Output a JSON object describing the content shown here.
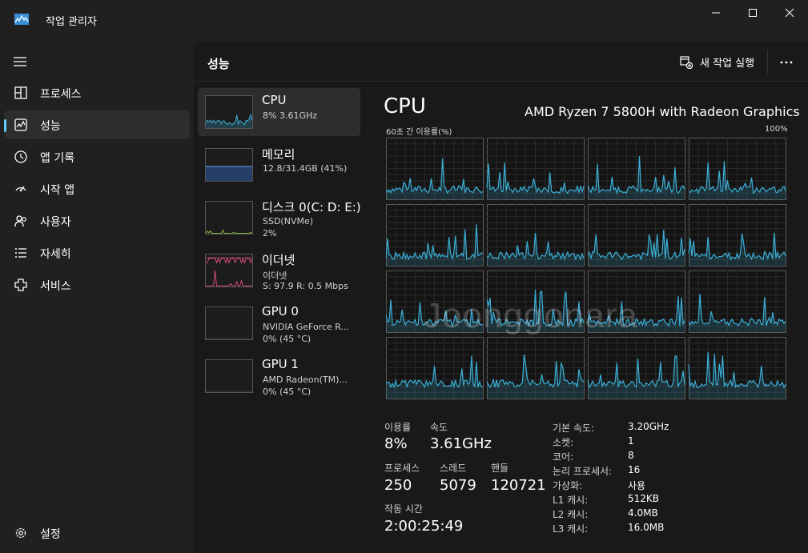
{
  "window": {
    "title": "작업 관리자"
  },
  "sidebar": {
    "items": [
      {
        "label": "프로세스",
        "icon": "processes-icon"
      },
      {
        "label": "성능",
        "icon": "performance-icon",
        "active": true
      },
      {
        "label": "앱 기록",
        "icon": "app-history-icon"
      },
      {
        "label": "시작 앱",
        "icon": "startup-apps-icon"
      },
      {
        "label": "사용자",
        "icon": "users-icon"
      },
      {
        "label": "자세히",
        "icon": "details-icon"
      },
      {
        "label": "서비스",
        "icon": "services-icon"
      }
    ],
    "settings_label": "설정"
  },
  "header": {
    "page_title": "성능",
    "run_task_label": "새 작업 실행",
    "more_label": "..."
  },
  "devices": [
    {
      "name": "CPU",
      "sub1": "8% 3.61GHz",
      "sub2": ""
    },
    {
      "name": "메모리",
      "sub1": "12.8/31.4GB (41%)",
      "sub2": ""
    },
    {
      "name": "디스크 0(C: D: E:)",
      "sub1": "SSD(NVMe)",
      "sub2": "2%"
    },
    {
      "name": "이더넷",
      "sub1": "이더넷",
      "sub2": "S: 97.9 R: 0.5 Mbps"
    },
    {
      "name": "GPU 0",
      "sub1": "NVIDIA GeForce R...",
      "sub2": "0% (45 °C)"
    },
    {
      "name": "GPU 1",
      "sub1": "AMD Radeon(TM)...",
      "sub2": "0% (45 °C)"
    }
  ],
  "cpu": {
    "title": "CPU",
    "model": "AMD Ryzen 7 5800H with Radeon Graphics",
    "graph_caption": "60초 간 이용률(%)",
    "graph_max": "100%",
    "logical_processor_graphs": 16,
    "accent_color": "#3bb0d8"
  },
  "stats": {
    "utilization_label": "이용률",
    "utilization_value": "8%",
    "speed_label": "속도",
    "speed_value": "3.61GHz",
    "processes_label": "프로세스",
    "processes_value": "250",
    "threads_label": "스레드",
    "threads_value": "5079",
    "handles_label": "핸들",
    "handles_value": "120721",
    "uptime_label": "작동 시간",
    "uptime_value": "2:00:25:49"
  },
  "specs": [
    {
      "key": "기본 속도:",
      "value": "3.20GHz"
    },
    {
      "key": "소켓:",
      "value": "1"
    },
    {
      "key": "코어:",
      "value": "8"
    },
    {
      "key": "논리 프로세서:",
      "value": "16"
    },
    {
      "key": "가상화:",
      "value": "사용"
    },
    {
      "key": "L1 캐시:",
      "value": "512KB"
    },
    {
      "key": "L2 캐시:",
      "value": "4.0MB"
    },
    {
      "key": "L3 캐시:",
      "value": "16.0MB"
    }
  ],
  "watermark": "Joonggonara"
}
